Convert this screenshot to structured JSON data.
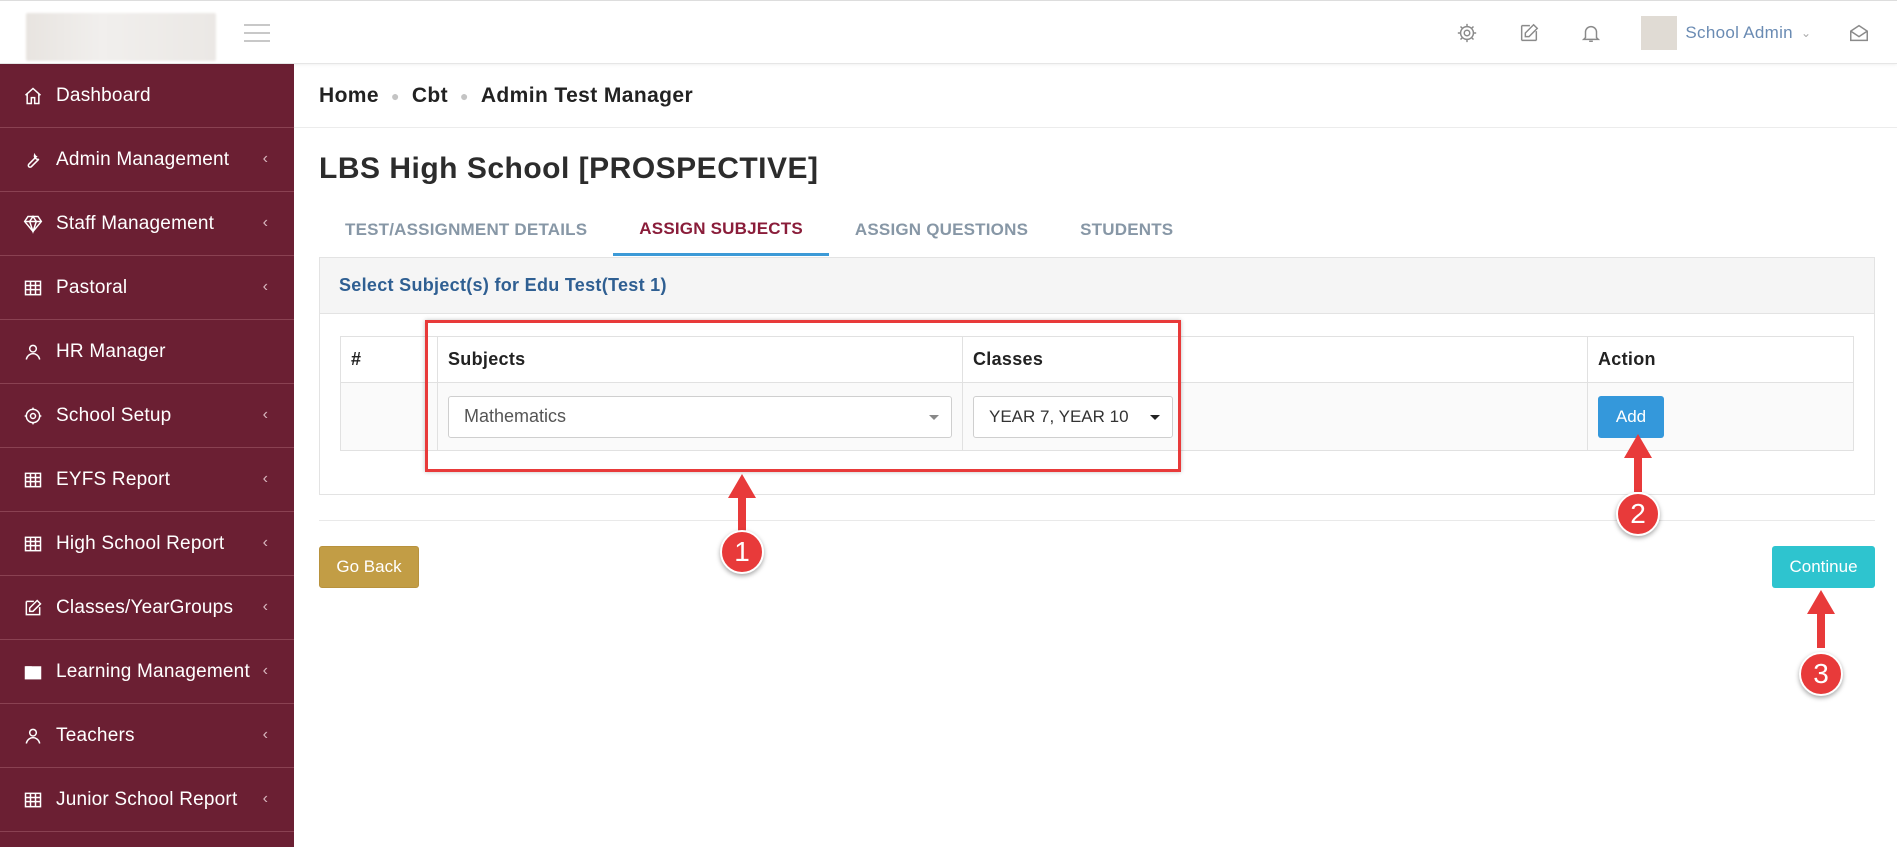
{
  "topbar": {
    "user_name": "School Admin",
    "icons": [
      "gear-icon",
      "edit-icon",
      "bell-icon",
      "envelope-icon"
    ]
  },
  "sidebar": {
    "items": [
      {
        "label": "Dashboard",
        "icon": "home-icon",
        "has_arrow": false
      },
      {
        "label": "Admin Management",
        "icon": "wrench-icon",
        "has_arrow": true
      },
      {
        "label": "Staff Management",
        "icon": "diamond-icon",
        "has_arrow": true
      },
      {
        "label": "Pastoral",
        "icon": "table-icon",
        "has_arrow": true
      },
      {
        "label": "HR Manager",
        "icon": "user-icon",
        "has_arrow": false
      },
      {
        "label": "School Setup",
        "icon": "gear-icon",
        "has_arrow": true
      },
      {
        "label": "EYFS Report",
        "icon": "table-icon",
        "has_arrow": true
      },
      {
        "label": "High School Report",
        "icon": "table-icon",
        "has_arrow": true
      },
      {
        "label": "Classes/YearGroups",
        "icon": "edit-icon",
        "has_arrow": true
      },
      {
        "label": "Learning Management",
        "icon": "folder-icon",
        "has_arrow": true
      },
      {
        "label": "Teachers",
        "icon": "user-icon",
        "has_arrow": true
      },
      {
        "label": "Junior School Report",
        "icon": "table-icon",
        "has_arrow": true
      }
    ]
  },
  "breadcrumb": [
    "Home",
    "Cbt",
    "Admin Test Manager"
  ],
  "page_title": "LBS High School [PROSPECTIVE]",
  "tabs": [
    {
      "label": "TEST/ASSIGNMENT DETAILS",
      "active": false
    },
    {
      "label": "ASSIGN SUBJECTS",
      "active": true
    },
    {
      "label": "ASSIGN QUESTIONS",
      "active": false
    },
    {
      "label": "STUDENTS",
      "active": false
    }
  ],
  "panel": {
    "heading": "Select Subject(s) for Edu Test(Test 1)",
    "columns": [
      "#",
      "Subjects",
      "Classes",
      "Action"
    ],
    "row": {
      "subject": "Mathematics",
      "classes": "YEAR 7,  YEAR 10",
      "action_label": "Add"
    }
  },
  "buttons": {
    "back": "Go Back",
    "continue": "Continue"
  },
  "annotations": {
    "markers": [
      "1",
      "2",
      "3"
    ],
    "color": "#e83a3a"
  },
  "colors": {
    "sidebar": "#6b1f33",
    "active_tab": "#8a1d3a",
    "tab_underline": "#3c9ad7",
    "add": "#3498db",
    "back": "#c29d45",
    "continue": "#2ec4cf"
  }
}
